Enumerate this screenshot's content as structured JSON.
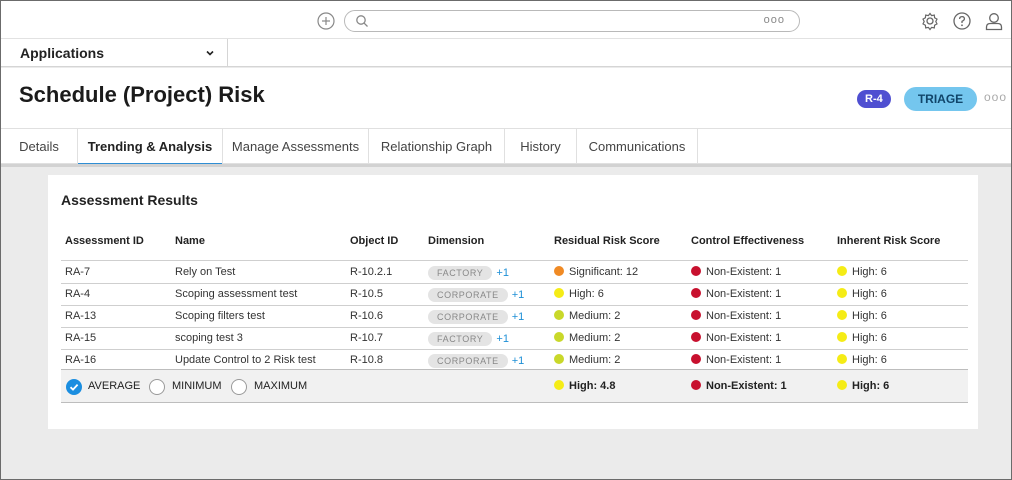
{
  "topbar": {
    "add_icon": "plus-circle-icon",
    "search_icon": "search-icon",
    "search_placeholder": "",
    "search_more": "ooo",
    "settings_icon": "gear-icon",
    "help_icon": "question-icon",
    "user_icon": "user-icon"
  },
  "appbar": {
    "label": "Applications"
  },
  "header": {
    "title": "Schedule (Project) Risk",
    "id_badge": "R-4",
    "state_badge": "TRIAGE",
    "more": "ooo"
  },
  "tabs": [
    {
      "label": "Details"
    },
    {
      "label": "Trending & Analysis"
    },
    {
      "label": "Manage Assessments"
    },
    {
      "label": "Relationship Graph"
    },
    {
      "label": "History"
    },
    {
      "label": "Communications"
    }
  ],
  "card": {
    "title": "Assessment Results",
    "columns": [
      "Assessment ID",
      "Name",
      "Object ID",
      "Dimension",
      "Residual Risk Score",
      "Control Effectiveness",
      "Inherent Risk Score"
    ],
    "rows": [
      {
        "id": "RA-7",
        "name": "Rely on Test",
        "object_id": "R-10.2.1",
        "dimension": "FACTORY",
        "dim_more": "+1",
        "residual": "Significant: 12",
        "control": "Non-Existent: 1",
        "inherent": "High: 6"
      },
      {
        "id": "RA-4",
        "name": "Scoping assessment test",
        "object_id": "R-10.5",
        "dimension": "CORPORATE",
        "dim_more": "+1",
        "residual": "High: 6",
        "control": "Non-Existent: 1",
        "inherent": "High: 6"
      },
      {
        "id": "RA-13",
        "name": "Scoping filters test",
        "object_id": "R-10.6",
        "dimension": "CORPORATE",
        "dim_more": "+1",
        "residual": "Medium: 2",
        "control": "Non-Existent: 1",
        "inherent": "High: 6"
      },
      {
        "id": "RA-15",
        "name": "scoping test 3",
        "object_id": "R-10.7",
        "dimension": "FACTORY",
        "dim_more": "+1",
        "residual": "Medium: 2",
        "control": "Non-Existent: 1",
        "inherent": "High: 6"
      },
      {
        "id": "RA-16",
        "name": "Update Control to 2 Risk test",
        "object_id": "R-10.8",
        "dimension": "CORPORATE",
        "dim_more": "+1",
        "residual": "Medium: 2",
        "control": "Non-Existent: 1",
        "inherent": "High: 6"
      }
    ],
    "summary": {
      "options": [
        "AVERAGE",
        "MINIMUM",
        "MAXIMUM"
      ],
      "selected": "AVERAGE",
      "residual": "High: 4.8",
      "control": "Non-Existent: 1",
      "inherent": "High: 6"
    }
  },
  "colors": {
    "significant": "#f08a24",
    "high": "#f5ec16",
    "medium": "#c9d82a",
    "non_existent": "#c8102e",
    "accent": "#2f8ed4",
    "id_badge": "#4f4fd1",
    "state_badge": "#74c6ee"
  }
}
